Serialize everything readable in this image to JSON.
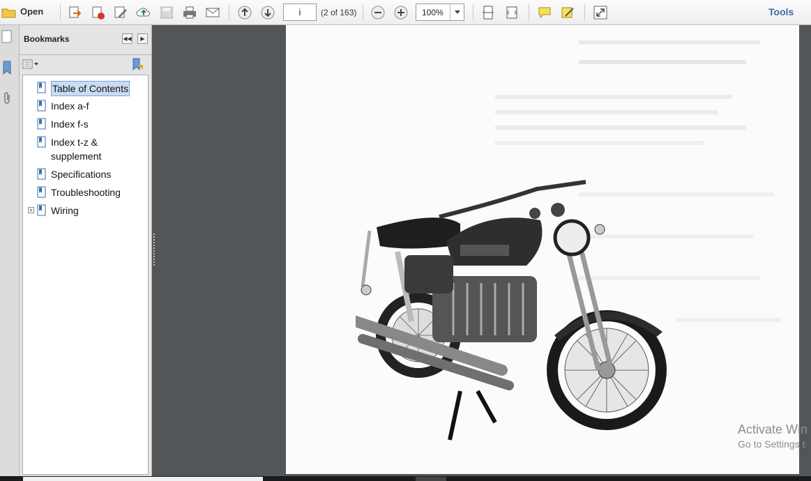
{
  "toolbar": {
    "open_label": "Open",
    "page_current": "i",
    "page_count": "(2 of 163)",
    "zoom": "100%",
    "tools_label": "Tools"
  },
  "bookmarks_panel": {
    "title": "Bookmarks",
    "items": [
      {
        "label": "Table of Contents",
        "selected": true
      },
      {
        "label": "Index a-f"
      },
      {
        "label": "Index f-s"
      },
      {
        "label": "Index t-z & supplement"
      },
      {
        "label": "Specifications"
      },
      {
        "label": "Troubleshooting"
      },
      {
        "label": "Wiring",
        "expandable": true
      }
    ]
  },
  "overlay": {
    "activate_title": "Activate Win",
    "activate_sub": "Go to Settings t"
  },
  "icons": [
    "open-folder-icon",
    "export-icon",
    "create-pdf-icon",
    "edit-icon",
    "upload-cloud-icon",
    "save-icon",
    "print-icon",
    "email-icon",
    "prev-page-icon",
    "next-page-icon",
    "zoom-out-icon",
    "zoom-in-icon",
    "fit-page-icon",
    "fit-width-icon",
    "comment-icon",
    "sign-icon",
    "fullscreen-icon"
  ],
  "colors": {
    "accent": "#3b6ea5",
    "workspace": "#525659",
    "selection": "#c9dcf2"
  }
}
